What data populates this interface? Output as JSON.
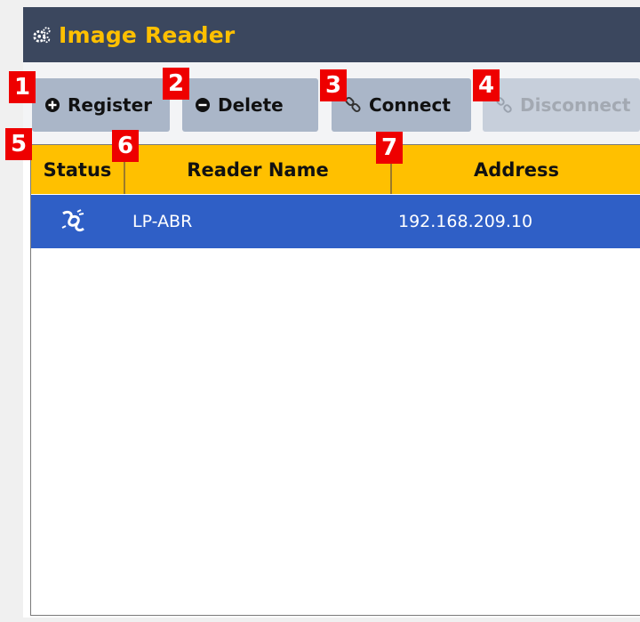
{
  "window": {
    "title": "Image Reader"
  },
  "toolbar": {
    "register_label": "Register",
    "delete_label": "Delete",
    "connect_label": "Connect",
    "disconnect_label": "Disconnect"
  },
  "table": {
    "columns": [
      "Status",
      "Reader Name",
      "Address"
    ],
    "rows": [
      {
        "status_icon": "connected-icon",
        "reader_name": "LP-ABR",
        "address": "192.168.209.10"
      }
    ]
  },
  "callouts": [
    "1",
    "2",
    "3",
    "4",
    "5",
    "6",
    "7"
  ],
  "colors": {
    "titlebar": "#3b475e",
    "title_text": "#ffc000",
    "header": "#ffc000",
    "selected_row": "#2f5fc6",
    "callout": "#ee0000"
  }
}
